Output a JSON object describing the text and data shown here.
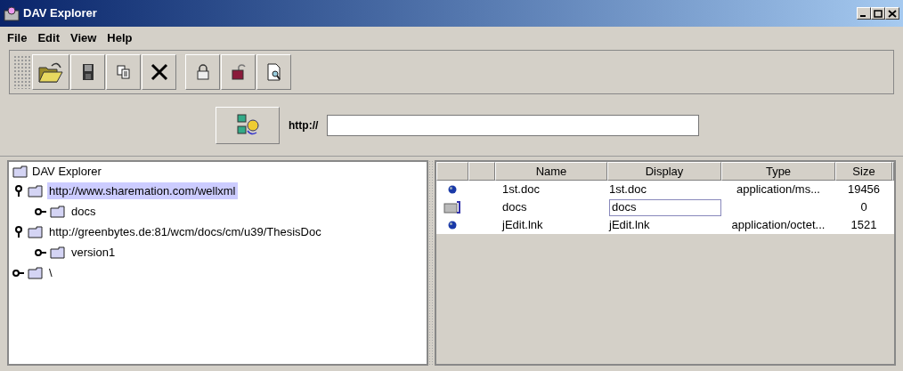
{
  "window": {
    "title": "DAV Explorer"
  },
  "menu": [
    "File",
    "Edit",
    "View",
    "Help"
  ],
  "toolbar": [
    {
      "kind": "open"
    },
    {
      "kind": "save"
    },
    {
      "kind": "copy"
    },
    {
      "kind": "delete"
    },
    {
      "kind": "sep"
    },
    {
      "kind": "lock"
    },
    {
      "kind": "unlock"
    },
    {
      "kind": "view"
    }
  ],
  "url_bar": {
    "label": "http://"
  },
  "tree": {
    "root": "DAV Explorer",
    "children": [
      {
        "label": "http://www.sharemation.com/wellxml",
        "selected": true,
        "expanded": true,
        "children": [
          {
            "label": "docs",
            "selected": false,
            "expanded": false
          }
        ]
      },
      {
        "label": "http://greenbytes.de:81/wcm/docs/cm/u39/ThesisDoc",
        "selected": false,
        "expanded": true,
        "children": [
          {
            "label": "version1",
            "selected": false,
            "expanded": false
          }
        ]
      },
      {
        "label": "\\",
        "selected": false,
        "expanded": false
      }
    ]
  },
  "table": {
    "columns": [
      "Name",
      "Display",
      "Type",
      "Size"
    ],
    "rows": [
      {
        "kind": "file",
        "name": "1st.doc",
        "display": "1st.doc",
        "editing": false,
        "type": "application/ms...",
        "size": "19456"
      },
      {
        "kind": "folder",
        "name": "docs",
        "display": "docs",
        "editing": true,
        "size": "0"
      },
      {
        "kind": "file",
        "name": "jEdit.lnk",
        "display": "jEdit.lnk",
        "editing": false,
        "type": "application/octet...",
        "size": "1521"
      }
    ]
  }
}
